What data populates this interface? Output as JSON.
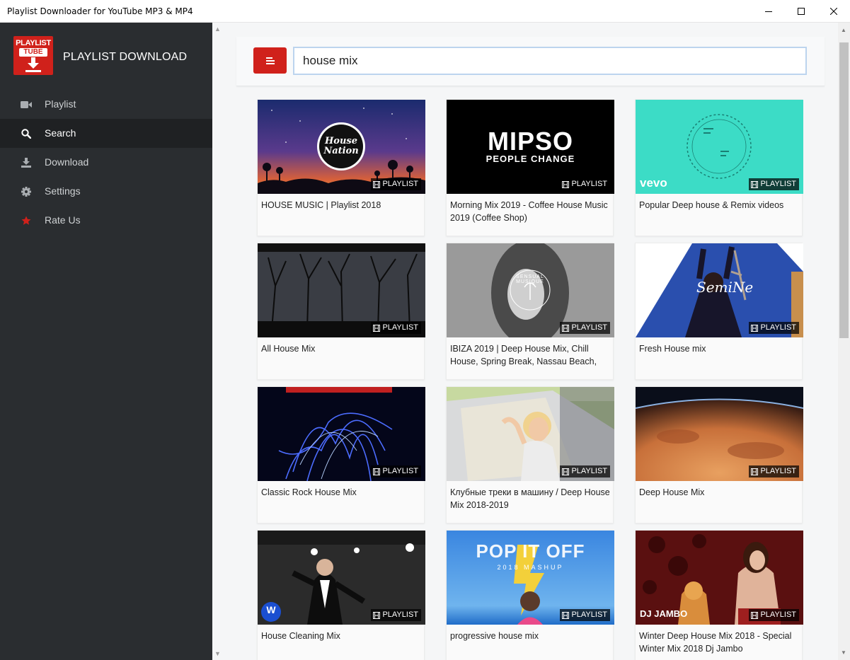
{
  "window": {
    "title": "Playlist Downloader for YouTube MP3 & MP4"
  },
  "brand": {
    "logo_line1": "PLAYLIST",
    "logo_line2": "TUBE",
    "name": "PLAYLIST DOWNLOAD"
  },
  "nav": [
    {
      "label": "Playlist",
      "icon": "video-camera-icon"
    },
    {
      "label": "Search",
      "icon": "search-icon",
      "active": true
    },
    {
      "label": "Download",
      "icon": "download-icon"
    },
    {
      "label": "Settings",
      "icon": "gear-icon"
    },
    {
      "label": "Rate Us",
      "icon": "star-icon"
    }
  ],
  "search": {
    "value": "house mix"
  },
  "badge_label": "PLAYLIST",
  "results": [
    {
      "title": "HOUSE MUSIC | Playlist 2018",
      "thumb_text": "House Nation"
    },
    {
      "title": "Morning Mix 2019 - Coffee House Music 2019 (Coffee Shop)",
      "thumb_text": "MIPSO",
      "thumb_subtext": "PEOPLE CHANGE"
    },
    {
      "title": "Popular Deep house & Remix videos",
      "thumb_text": "vevo"
    },
    {
      "title": "All House Mix"
    },
    {
      "title": "IBIZA 2019 | Deep House Mix, Chill House, Spring Break, Nassau Beach,",
      "thumb_text": "SENSUAL MUSIQUE"
    },
    {
      "title": "Fresh House mix",
      "thumb_text": "SemiNe"
    },
    {
      "title": "Classic Rock House Mix"
    },
    {
      "title": "Клубные треки в машину / Deep House Mix 2018-2019"
    },
    {
      "title": "Deep House Mix"
    },
    {
      "title": "House Cleaning Mix"
    },
    {
      "title": "progressive house mix",
      "thumb_text": "POP IT OFF",
      "thumb_subtext": "2018 MASHUP"
    },
    {
      "title": "Winter Deep House Mix 2018 - Special Winter Mix 2018 Dj Jambo",
      "thumb_text": "DJ JAMBO"
    }
  ],
  "colors": {
    "sidebar_bg": "#2a2d30",
    "sidebar_active": "#1f2123",
    "accent_red": "#d0211b",
    "main_bg": "#f5f6f7"
  }
}
